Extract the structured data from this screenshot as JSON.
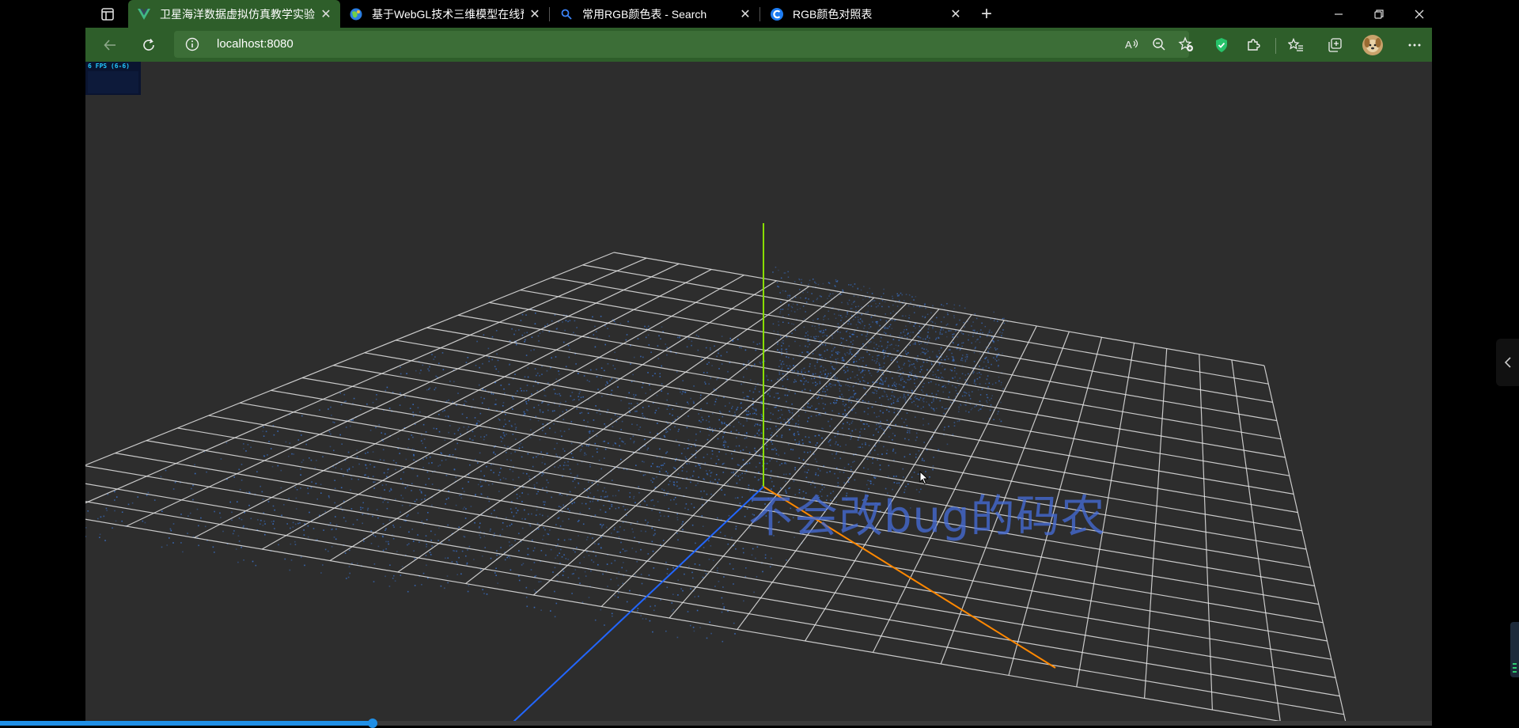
{
  "tabs": [
    {
      "title": "卫星海洋数据虚拟仿真教学实验",
      "favicon": "vue-logo-icon",
      "active": true
    },
    {
      "title": "基于WebGL技术三维模型在线预",
      "favicon": "globe-icon",
      "active": false
    },
    {
      "title": "常用RGB颜色表 - Search",
      "favicon": "search-icon",
      "active": false
    },
    {
      "title": "RGB颜色对照表",
      "favicon": "c-logo-icon",
      "active": false
    }
  ],
  "address": {
    "url": "localhost:8080"
  },
  "stats": {
    "fps_label": "6 FPS (6-6)"
  },
  "viewport": {
    "watermark": "不会改bug的码农",
    "background_color": "#2d2d2d",
    "grid_color": "#e6e6e6",
    "point_cloud_color": "#3c7be0",
    "axis_colors": {
      "x": "#ff8800",
      "y": "#88dd00",
      "z": "#2266ff"
    }
  },
  "video_progress": {
    "fraction": 0.26
  },
  "colors": {
    "tab_active": "#2e5e2a",
    "toolbar": "#2e5e2a",
    "addressbar": "#3c6e37",
    "progress": "#1f8fe6"
  }
}
